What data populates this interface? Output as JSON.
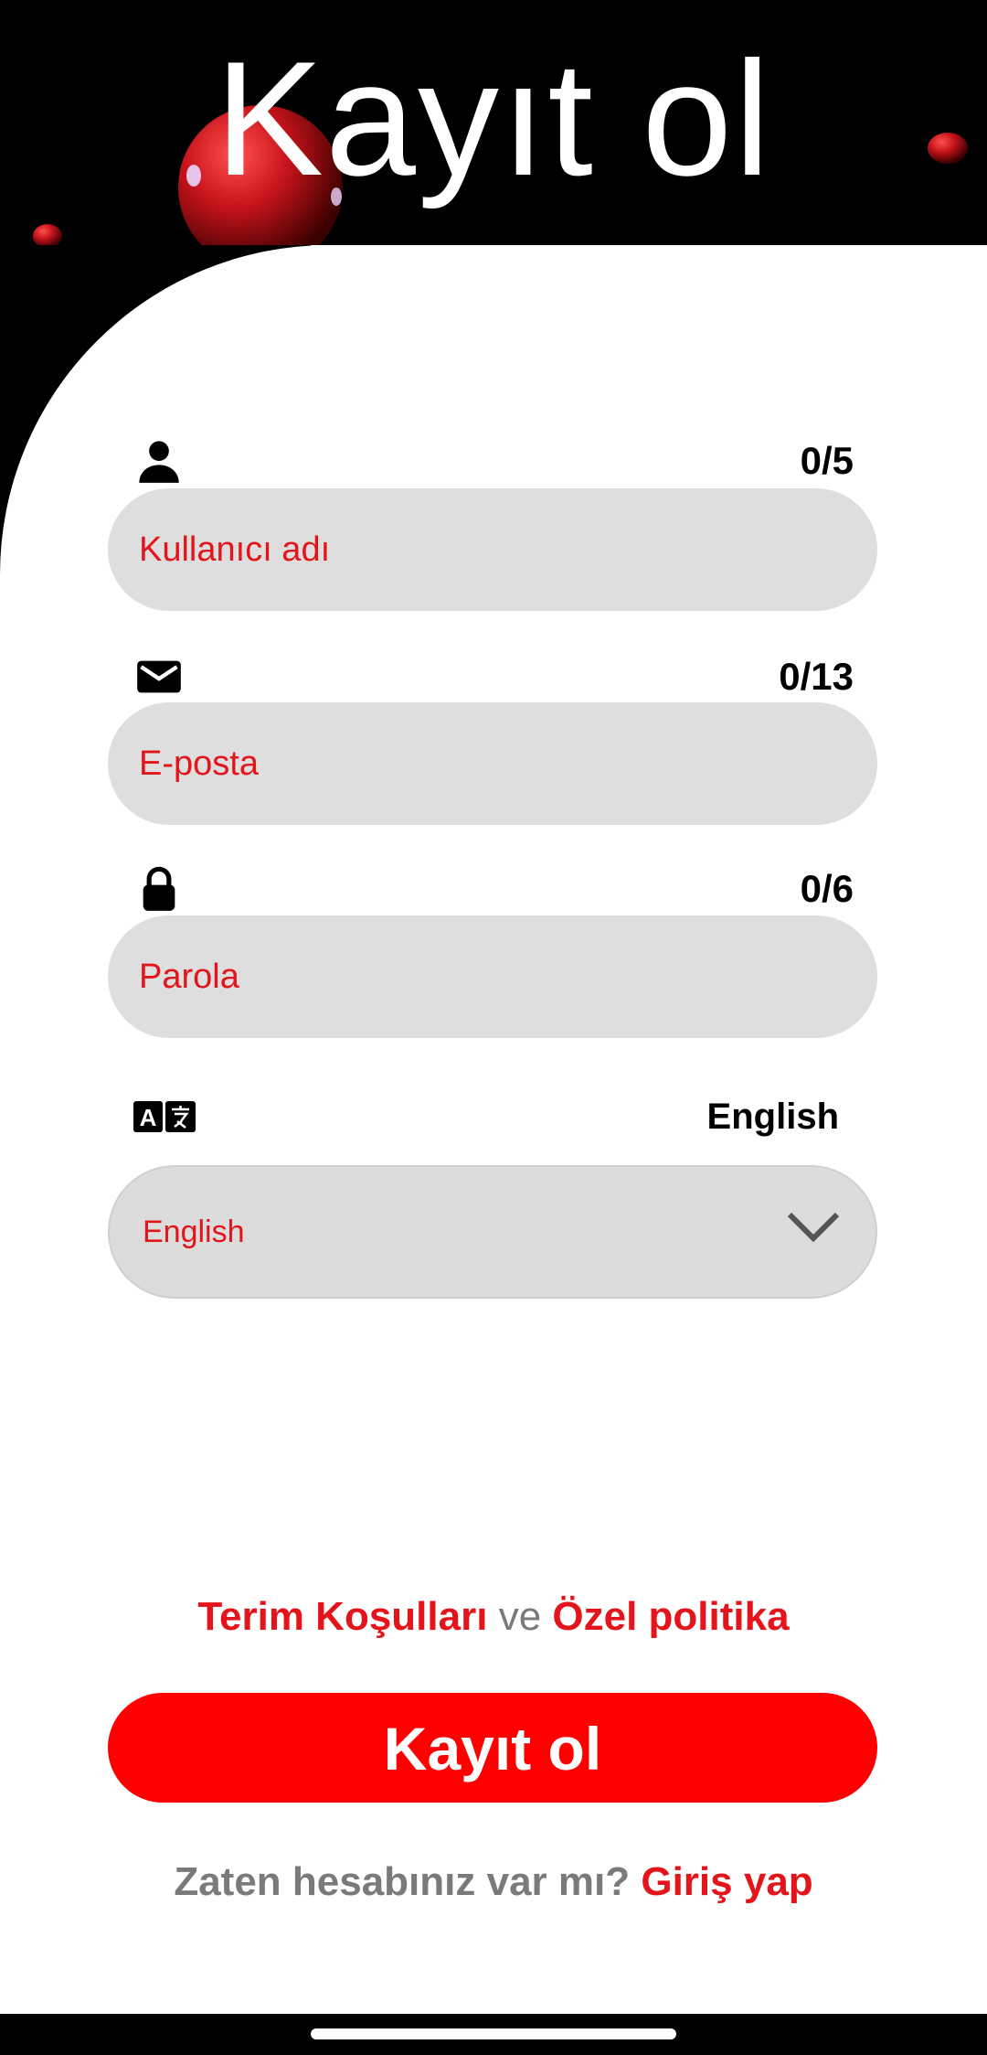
{
  "header": {
    "title": "Kayıt ol"
  },
  "fields": [
    {
      "icon": "person-icon",
      "counter": "0/5",
      "placeholder": "Kullanıcı adı"
    },
    {
      "icon": "mail-icon",
      "counter": "0/13",
      "placeholder": "E-posta"
    },
    {
      "icon": "lock-icon",
      "counter": "0/6",
      "placeholder": "Parola"
    }
  ],
  "language": {
    "icon": "translate-icon",
    "current_label": "English",
    "selected": "English"
  },
  "terms": {
    "terms_link": "Terim Koşulları",
    "conjunction": "ve",
    "privacy_link": "Özel politika"
  },
  "signup_button": "Kayıt ol",
  "login_prompt": {
    "question": "Zaten hesabınız var mı?",
    "link": "Giriş yap"
  },
  "colors": {
    "accent": "#ff0000",
    "link_red": "#e4141b",
    "field_bg": "#dedede",
    "header_bg": "#000000"
  }
}
